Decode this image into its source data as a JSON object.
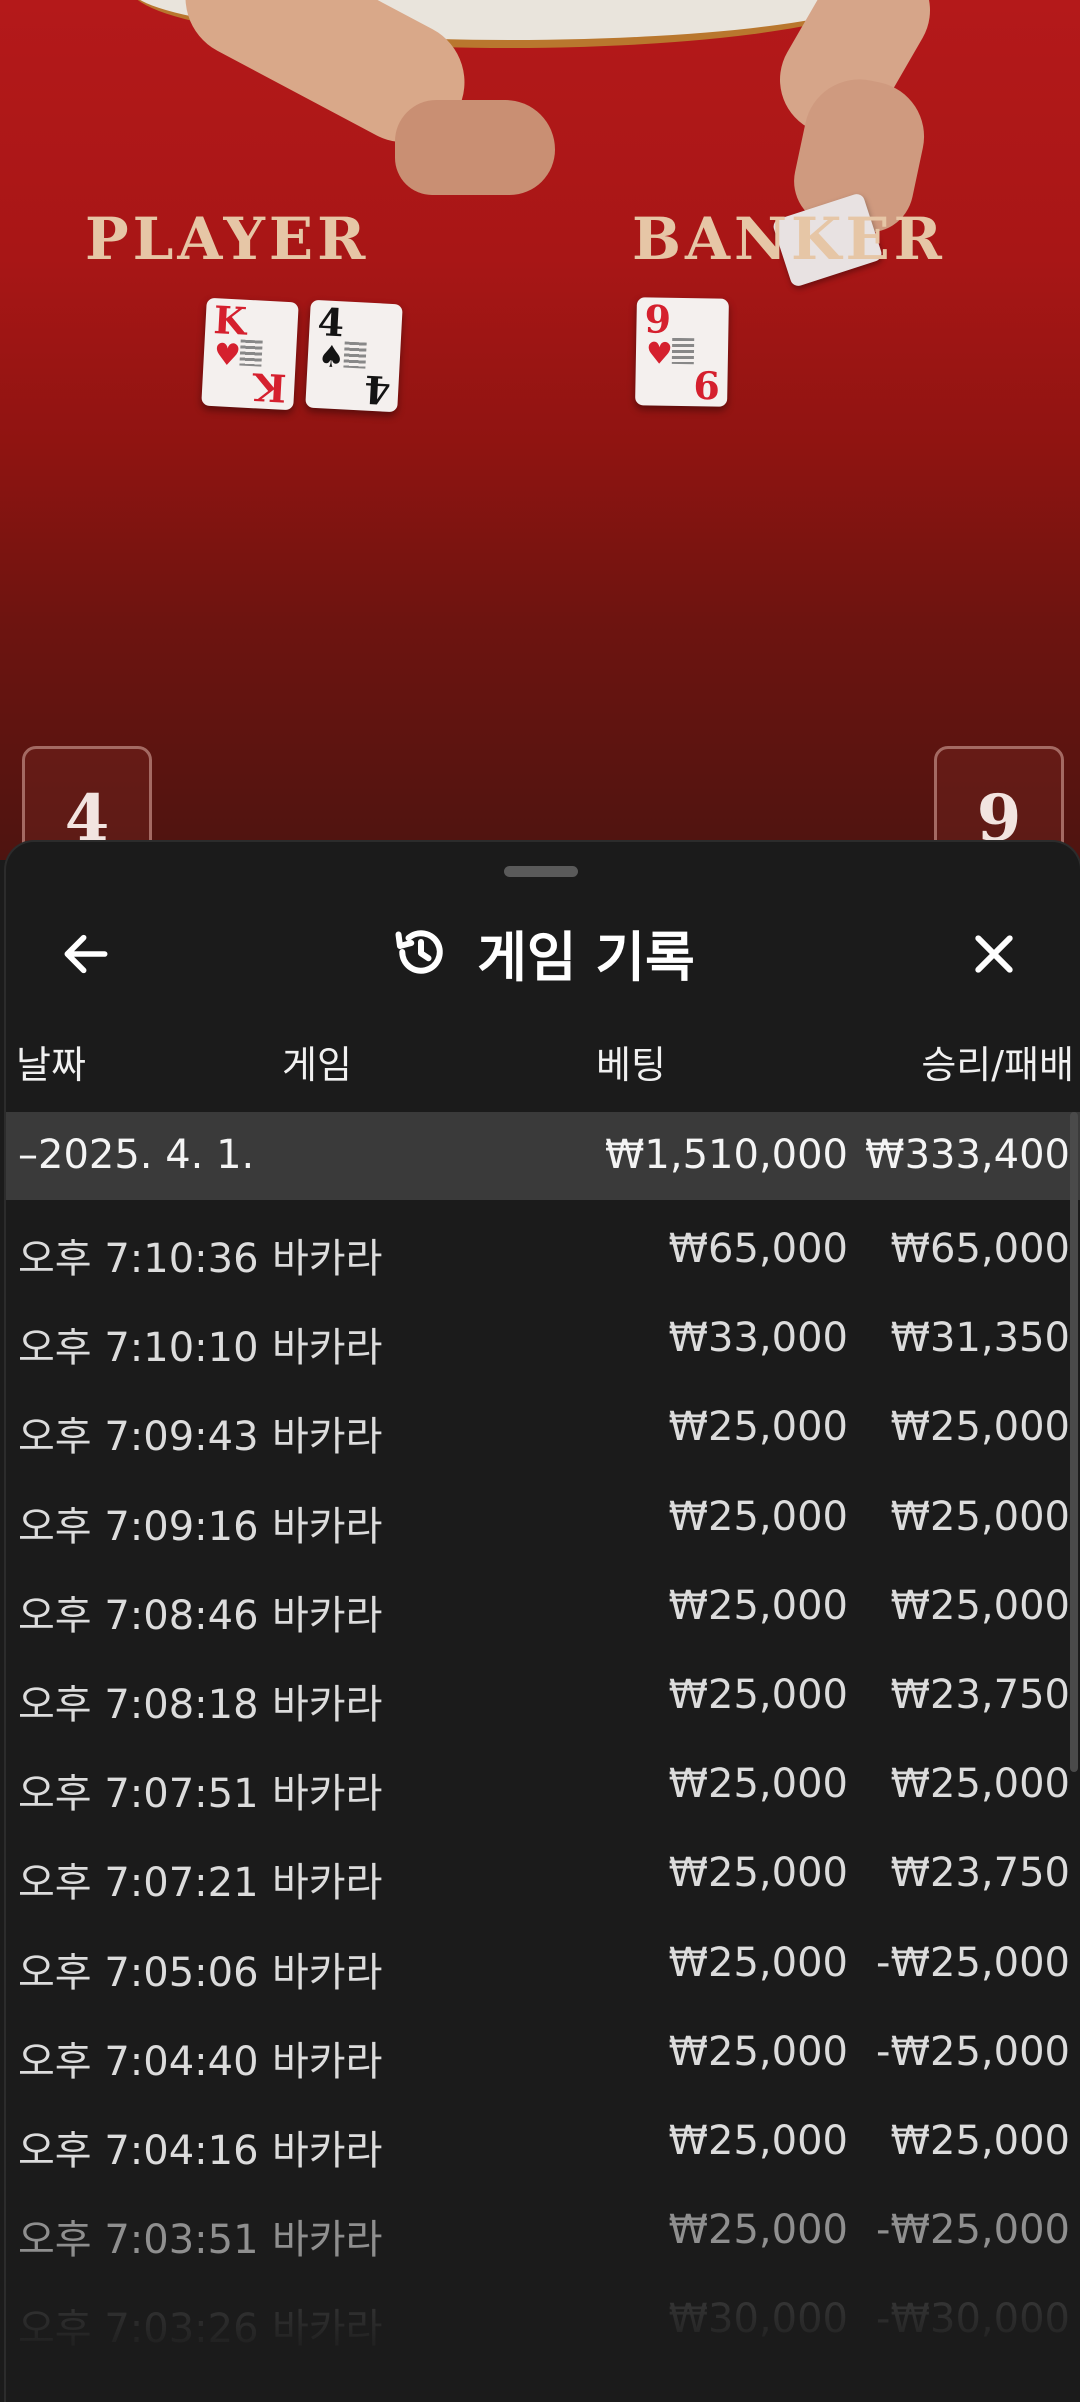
{
  "video": {
    "player_label": "PLAYER",
    "banker_label": "BANKER",
    "player_cards": [
      {
        "rank": "K",
        "suit": "♥"
      },
      {
        "rank": "4",
        "suit": "♠"
      }
    ],
    "banker_cards": [
      {
        "rank": "9",
        "suit": "♥"
      }
    ],
    "player_score": "4",
    "banker_score": "9"
  },
  "sheet": {
    "title": "게임 기록",
    "icons": {
      "back": "arrow-left-icon",
      "history": "history-icon",
      "close": "close-icon"
    },
    "columns": {
      "date": "날짜",
      "game": "게임",
      "bet": "베팅",
      "win": "승리/패배"
    },
    "summary": {
      "date": "–2025. 4. 1.",
      "bet": "₩1,510,000",
      "win": "₩333,400"
    },
    "rows": [
      {
        "time": "오후 7:10:36",
        "game": "바카라",
        "bet": "₩65,000",
        "win": "₩65,000"
      },
      {
        "time": "오후 7:10:10",
        "game": "바카라",
        "bet": "₩33,000",
        "win": "₩31,350"
      },
      {
        "time": "오후 7:09:43",
        "game": "바카라",
        "bet": "₩25,000",
        "win": "₩25,000"
      },
      {
        "time": "오후 7:09:16",
        "game": "바카라",
        "bet": "₩25,000",
        "win": "₩25,000"
      },
      {
        "time": "오후 7:08:46",
        "game": "바카라",
        "bet": "₩25,000",
        "win": "₩25,000"
      },
      {
        "time": "오후 7:08:18",
        "game": "바카라",
        "bet": "₩25,000",
        "win": "₩23,750"
      },
      {
        "time": "오후 7:07:51",
        "game": "바카라",
        "bet": "₩25,000",
        "win": "₩25,000"
      },
      {
        "time": "오후 7:07:21",
        "game": "바카라",
        "bet": "₩25,000",
        "win": "₩23,750"
      },
      {
        "time": "오후 7:05:06",
        "game": "바카라",
        "bet": "₩25,000",
        "win": "-₩25,000"
      },
      {
        "time": "오후 7:04:40",
        "game": "바카라",
        "bet": "₩25,000",
        "win": "-₩25,000"
      },
      {
        "time": "오후 7:04:16",
        "game": "바카라",
        "bet": "₩25,000",
        "win": "₩25,000"
      },
      {
        "time": "오후 7:03:51",
        "game": "바카라",
        "bet": "₩25,000",
        "win": "-₩25,000"
      },
      {
        "time": "오후 7:03:26",
        "game": "바카라",
        "bet": "₩30,000",
        "win": "-₩30,000"
      }
    ]
  },
  "colors": {
    "sheet_bg": "#1b1b1b",
    "summary_bg": "#3a3a3a",
    "felt": "#a81616",
    "text": "#dcdcdc"
  }
}
